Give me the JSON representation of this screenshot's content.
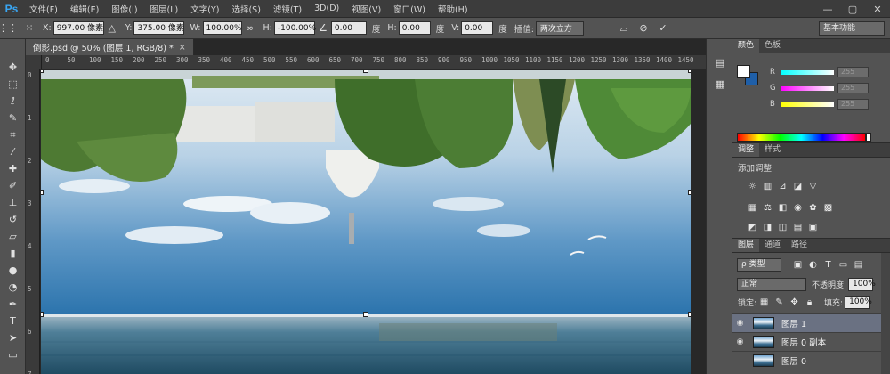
{
  "app": {
    "logo": "Ps",
    "menu": [
      "文件(F)",
      "编辑(E)",
      "图像(I)",
      "图层(L)",
      "文字(Y)",
      "选择(S)",
      "滤镜(T)",
      "3D(D)",
      "视图(V)",
      "窗口(W)",
      "帮助(H)"
    ],
    "window_controls": [
      "—",
      "▢",
      "✕"
    ]
  },
  "options_bar": {
    "x_label": "X:",
    "x_value": "997.00 像素",
    "y_label": "Y:",
    "y_value": "375.00 像素",
    "w_label": "W:",
    "w_value": "100.00%",
    "h_label": "H:",
    "h_value": "-100.00%",
    "angle_value": "0.00",
    "angle_unit": "度",
    "hskew_label": "H:",
    "hskew_value": "0.00",
    "hskew_unit": "度",
    "vskew_label": "V:",
    "vskew_value": "0.00",
    "vskew_unit": "度",
    "interp_label": "插值:",
    "interp_value": "两次立方",
    "workspace": "基本功能"
  },
  "document": {
    "tab_title": "倒影.psd @ 50% (图层 1, RGB/8) *",
    "tab_close": "×",
    "ruler_h": [
      "0",
      "50",
      "100",
      "150",
      "200",
      "250",
      "300",
      "350",
      "400",
      "450",
      "500",
      "550",
      "600",
      "650",
      "700",
      "750",
      "800",
      "850",
      "900",
      "950",
      "1000",
      "1050",
      "1100",
      "1150",
      "1200",
      "1250",
      "1300",
      "1350",
      "1400",
      "1450"
    ],
    "ruler_v": [
      "0",
      "1",
      "2",
      "3",
      "4",
      "5",
      "6",
      "7"
    ]
  },
  "panels": {
    "color_tabs": [
      "颜色",
      "色板"
    ],
    "sliders": [
      {
        "label": "R",
        "value": "255",
        "color": "#35d0d0"
      },
      {
        "label": "G",
        "value": "255",
        "color": "#d23ad2"
      },
      {
        "label": "B",
        "value": "255",
        "color": "#e2e23a"
      }
    ],
    "adjust_tabs": [
      "调整",
      "样式"
    ],
    "adjust_title": "添加调整",
    "layers_tabs": [
      "图层",
      "通道",
      "路径"
    ],
    "filter_kind": "ρ 类型",
    "blend_mode": "正常",
    "opacity_label": "不透明度:",
    "opacity_value": "100%",
    "lock_label": "锁定:",
    "fill_label": "填充:",
    "fill_value": "100%",
    "layers": [
      {
        "name": "图层 1",
        "visible": true,
        "active": true
      },
      {
        "name": "图层 0 副本",
        "visible": true,
        "active": false
      },
      {
        "name": "图层 0",
        "visible": false,
        "active": false
      }
    ]
  },
  "colors": {
    "accent_logo": "#39a7f5",
    "layer_selected": "#6a7182",
    "foreground": "#ffffff",
    "background": "#1f5fa8"
  }
}
